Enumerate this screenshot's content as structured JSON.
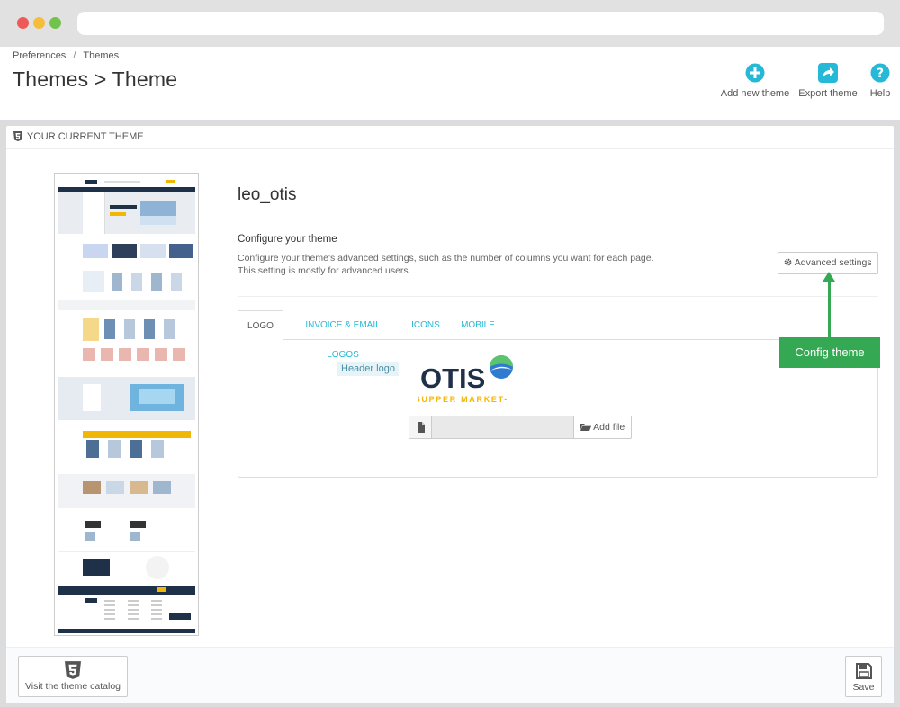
{
  "header": {
    "breadcrumb": [
      "Preferences",
      "Themes"
    ],
    "breadcrumb_sep": "/",
    "title": "Themes > Theme",
    "toolbar": [
      {
        "label": "Add new theme",
        "icon": "plus-circle-icon"
      },
      {
        "label": "Export theme",
        "icon": "share-icon"
      },
      {
        "label": "Help",
        "icon": "question-circle-icon"
      }
    ]
  },
  "panel": {
    "heading": "YOUR CURRENT THEME",
    "theme_name": "leo_otis",
    "config_title": "Configure your theme",
    "config_desc_line1": "Configure your theme's advanced settings, such as the number of columns you want for each page.",
    "config_desc_line2": "This setting is mostly for advanced users.",
    "advanced_button": "Advanced settings",
    "tabs": [
      "LOGO",
      "INVOICE & EMAIL LOGOS",
      "ICONS",
      "MOBILE"
    ],
    "header_logo_label": "Header logo",
    "logo_text": "OTIS",
    "logo_subtext": "-SUPPER MARKET-",
    "add_file_label": "Add file",
    "annotation": "Config theme"
  },
  "footer": {
    "catalog_button": "Visit the theme catalog",
    "save_button": "Save"
  },
  "colors": {
    "accent": "#25b9d7",
    "annotation": "#34a853",
    "logo_navy": "#1f3049",
    "logo_yellow": "#f2b705"
  }
}
